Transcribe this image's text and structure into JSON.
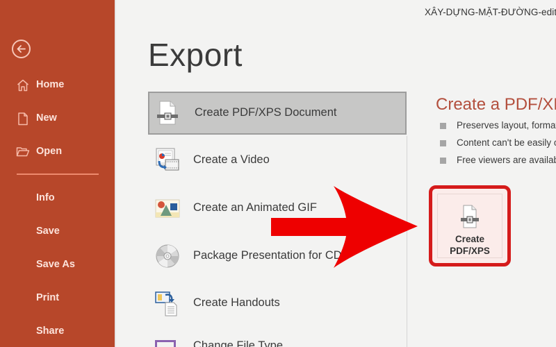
{
  "window": {
    "document_title": "XÂY-DỰNG-MẶT-ĐƯỜNG-edit"
  },
  "sidebar": {
    "back_icon": "arrow-left-circle-icon",
    "items": [
      {
        "label": "Home",
        "icon": "home-icon"
      },
      {
        "label": "New",
        "icon": "new-document-icon"
      },
      {
        "label": "Open",
        "icon": "open-folder-icon"
      },
      {
        "label": "Info"
      },
      {
        "label": "Save"
      },
      {
        "label": "Save As"
      },
      {
        "label": "Print"
      },
      {
        "label": "Share"
      }
    ],
    "accent_color": "#b7472a"
  },
  "main": {
    "title": "Export",
    "export_options": [
      {
        "label": "Create PDF/XPS Document",
        "icon": "pdf-document-icon",
        "selected": true
      },
      {
        "label": "Create a Video",
        "icon": "video-icon",
        "selected": false
      },
      {
        "label": "Create an Animated GIF",
        "icon": "animated-gif-icon",
        "selected": false
      },
      {
        "label": "Package Presentation for CD",
        "icon": "cd-icon",
        "selected": false
      },
      {
        "label": "Create Handouts",
        "icon": "handouts-icon",
        "selected": false
      },
      {
        "label": "Change File Type",
        "icon": "file-type-icon",
        "selected": false
      }
    ]
  },
  "detail_panel": {
    "title": "Create a PDF/XPS Document",
    "bullets": [
      "Preserves layout, formatting, fonts, and images",
      "Content can't be easily changed",
      "Free viewers are available on the web"
    ],
    "create_button": {
      "line1": "Create",
      "line2": "PDF/XPS",
      "icon": "pdf-document-icon"
    },
    "highlight_color": "#d51b1b"
  },
  "annotation": {
    "type": "arrow",
    "color": "#ee0000",
    "points_to": "create-pdf-xps-button"
  }
}
